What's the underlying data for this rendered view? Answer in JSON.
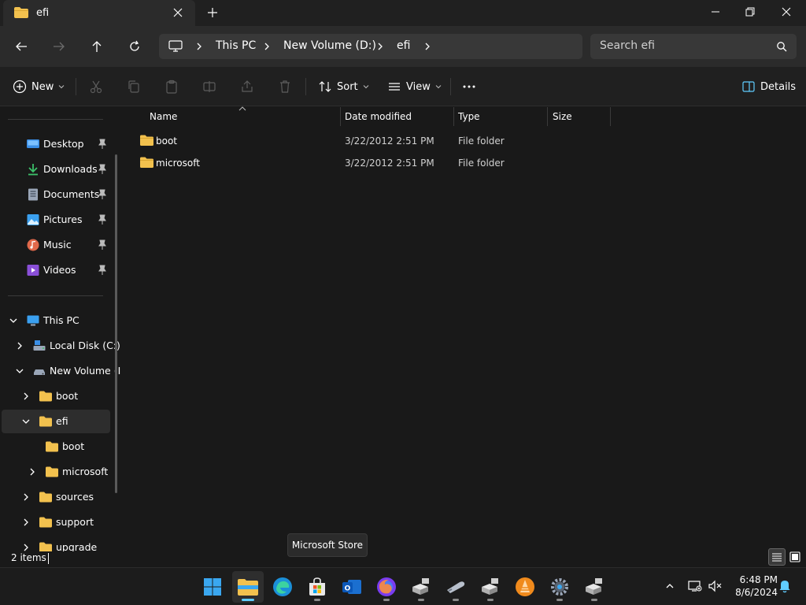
{
  "tab": {
    "title": "efi"
  },
  "window": {
    "minimize": "minimize",
    "maximize": "restore",
    "close": "close"
  },
  "address": {
    "crumbs": [
      "This PC",
      "New Volume (D:)",
      "efi"
    ]
  },
  "search": {
    "placeholder": "Search efi"
  },
  "toolbar": {
    "new_label": "New",
    "sort_label": "Sort",
    "view_label": "View",
    "details_label": "Details"
  },
  "sidebar": {
    "quick_access": [
      {
        "label": "Desktop",
        "icon": "desktop-icon",
        "color": "#3a8ee6"
      },
      {
        "label": "Downloads",
        "icon": "downloads-icon",
        "color": "#3cc06a"
      },
      {
        "label": "Documents",
        "icon": "documents-icon",
        "color": "#9aa6b8"
      },
      {
        "label": "Pictures",
        "icon": "pictures-icon",
        "color": "#3aa0f0"
      },
      {
        "label": "Music",
        "icon": "music-icon",
        "color": "#e0684a"
      },
      {
        "label": "Videos",
        "icon": "videos-icon",
        "color": "#8a4fd8"
      }
    ],
    "tree": [
      {
        "label": "This PC",
        "level": 0,
        "expander": "open",
        "icon": "pc"
      },
      {
        "label": "Local Disk (C:)",
        "level": 1,
        "expander": "closed",
        "icon": "disk"
      },
      {
        "label": "New Volume (I",
        "level": 1,
        "expander": "open",
        "icon": "drive"
      },
      {
        "label": "boot",
        "level": 2,
        "expander": "closed",
        "icon": "folder"
      },
      {
        "label": "efi",
        "level": 2,
        "expander": "open",
        "icon": "folder",
        "selected": true
      },
      {
        "label": "boot",
        "level": 3,
        "expander": "none",
        "icon": "folder"
      },
      {
        "label": "microsoft",
        "level": 3,
        "expander": "closed",
        "icon": "folder"
      },
      {
        "label": "sources",
        "level": 2,
        "expander": "closed",
        "icon": "folder"
      },
      {
        "label": "support",
        "level": 2,
        "expander": "closed",
        "icon": "folder"
      },
      {
        "label": "upgrade",
        "level": 2,
        "expander": "closed",
        "icon": "folder"
      }
    ]
  },
  "columns": [
    "Name",
    "Date modified",
    "Type",
    "Size"
  ],
  "files": [
    {
      "name": "boot",
      "date": "3/22/2012 2:51 PM",
      "type": "File folder",
      "size": ""
    },
    {
      "name": "microsoft",
      "date": "3/22/2012 2:51 PM",
      "type": "File folder",
      "size": ""
    }
  ],
  "status": {
    "items": "2 items"
  },
  "tooltip": {
    "text": "Microsoft Store"
  },
  "taskbar": {
    "apps": [
      "start-icon",
      "file-explorer-icon",
      "edge-icon",
      "microsoft-store-icon",
      "outlook-icon",
      "firefox-icon",
      "installer-icon",
      "usb-icon",
      "installer-icon",
      "vlc-icon",
      "settings-icon",
      "installer-icon"
    ]
  },
  "clock": {
    "time": "6:48 PM",
    "date": "8/6/2024"
  },
  "colors": {
    "folder": "#f2c14e",
    "accent": "#60cdff"
  }
}
